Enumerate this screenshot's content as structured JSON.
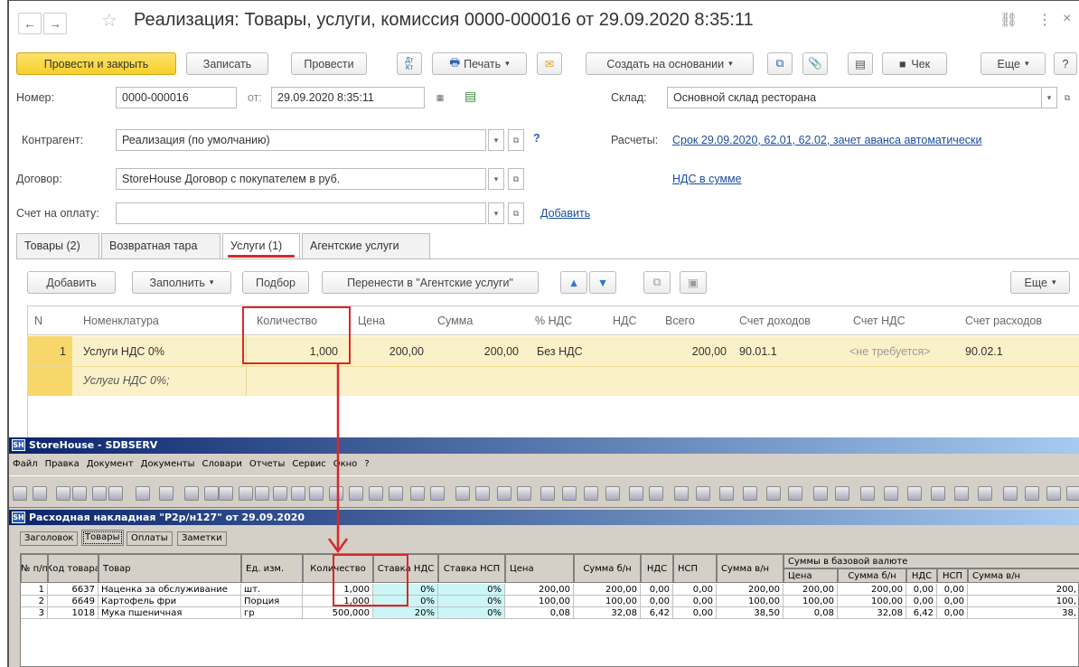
{
  "window": {
    "title": "Реализация: Товары, услуги, комиссия 0000-000016 от 29.09.2020 8:35:11",
    "icons": [
      "back-arrow-icon",
      "forward-arrow-icon",
      "star-icon",
      "link-icon",
      "more-vert-icon",
      "close-icon"
    ]
  },
  "toolbar": {
    "post_close": "Провести и закрыть",
    "save": "Записать",
    "post": "Провести",
    "dtkt_top": "Дт",
    "dtkt_bottom": "Кт",
    "print": "Печать",
    "create_based": "Создать на основании",
    "receipt": "Чек",
    "more": "Еще",
    "help": "?"
  },
  "form": {
    "number_label": "Номер:",
    "number": "0000-000016",
    "from_label": "от:",
    "date": "29.09.2020  8:35:11",
    "warehouse_label": "Склад:",
    "warehouse": "Основной склад ресторана",
    "contractor_label": "Контрагент:",
    "contractor": "Реализация (по умолчанию)",
    "question": "?",
    "settlements_label": "Расчеты:",
    "settlements_link": "Срок 29.09.2020, 62.01, 62.02, зачет аванса автоматически",
    "contract_label": "Договор:",
    "contract": "StoreHouse Договор с покупателем в руб.",
    "vat_link": "НДС в сумме",
    "invoice_label": "Счет на оплату:",
    "invoice": "",
    "add_link": "Добавить"
  },
  "tabs": [
    "Товары (2)",
    "Возвратная тара",
    "Услуги (1)",
    "Агентские услуги"
  ],
  "services": {
    "add": "Добавить",
    "fill": "Заполнить",
    "pick": "Подбор",
    "move": "Перенести в \"Агентские услуги\"",
    "more": "Еще",
    "headers": [
      "N",
      "Номенклатура",
      "Количество",
      "Цена",
      "Сумма",
      "% НДС",
      "НДС",
      "Всего",
      "Счет доходов",
      "Счет НДС",
      "Счет расходов"
    ],
    "row": {
      "n": "1",
      "item": "Услуги НДС 0%",
      "qty": "1,000",
      "price": "200,00",
      "sum": "200,00",
      "vat_rate": "Без НДС",
      "vat": "",
      "total": "200,00",
      "income": "90.01.1",
      "vat_account": "<не требуется>",
      "expense": "90.02.1",
      "content": "Услуги НДС 0%;"
    }
  },
  "storehouse": {
    "app_title": "StoreHouse - SDBSERV",
    "menu": [
      "Файл",
      "Правка",
      "Документ",
      "Документы",
      "Словари",
      "Отчеты",
      "Сервис",
      "Окно",
      "?"
    ],
    "doc_title": "Расходная накладная \"Р2р/н127\" от 29.09.2020",
    "doc_tabs": [
      "Заголовок",
      "Товары",
      "Оплаты",
      "Заметки"
    ],
    "headers": [
      "№ п/п",
      "Код товара",
      "Товар",
      "Ед. изм.",
      "Количество",
      "Ставка НДС",
      "Ставка НСП",
      "Цена",
      "Сумма б/н",
      "НДС",
      "НСП",
      "Сумма в/н"
    ],
    "base_group": "Суммы в базовой валюте",
    "base_headers": [
      "Цена",
      "Сумма б/н",
      "НДС",
      "НСП",
      "Сумма в/н"
    ],
    "rows": [
      [
        "1",
        "6637",
        "Наценка за обслуживание",
        "шт.",
        "1,000",
        "0%",
        "0%",
        "200,00",
        "200,00",
        "0,00",
        "0,00",
        "200,00",
        "200,00",
        "200,00",
        "0,00",
        "0,00",
        "200,"
      ],
      [
        "2",
        "6649",
        "Картофель фри",
        "Порция",
        "1,000",
        "0%",
        "0%",
        "100,00",
        "100,00",
        "0,00",
        "0,00",
        "100,00",
        "100,00",
        "100,00",
        "0,00",
        "0,00",
        "100,"
      ],
      [
        "3",
        "1018",
        "Мука пшеничная",
        "гр",
        "500,000",
        "20%",
        "0%",
        "0,08",
        "32,08",
        "6,42",
        "0,00",
        "38,50",
        "0,08",
        "32,08",
        "6,42",
        "0,00",
        "38,"
      ]
    ]
  },
  "annotation_color": "#d8282b"
}
